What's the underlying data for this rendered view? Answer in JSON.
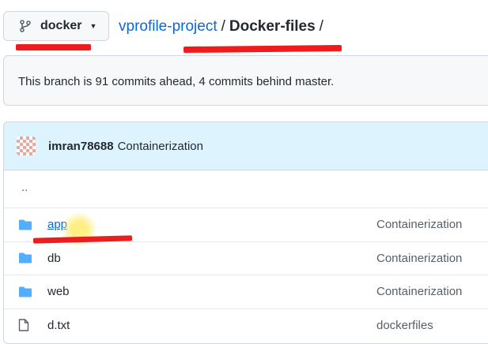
{
  "nav": {
    "branch_label": "docker",
    "repo_name": "vprofile-project",
    "separator": "/",
    "current_dir": "Docker-files",
    "trailing_separator": "/"
  },
  "banner": {
    "text": "This branch is 91 commits ahead, 4 commits behind master."
  },
  "commit": {
    "author": "imran78688",
    "message": "Containerization"
  },
  "parent_dir": "..",
  "files": [
    {
      "icon": "folder-icon",
      "name": "app",
      "message": "Containerization"
    },
    {
      "icon": "folder-icon",
      "name": "db",
      "message": "Containerization"
    },
    {
      "icon": "folder-icon",
      "name": "web",
      "message": "Containerization"
    },
    {
      "icon": "file-icon",
      "name": "d.txt",
      "message": "dockerfiles"
    }
  ],
  "colors": {
    "link": "#0969da",
    "folder": "#54aeff",
    "annotation": "#ee1c1c",
    "commit_header_bg": "#ddf4ff"
  }
}
